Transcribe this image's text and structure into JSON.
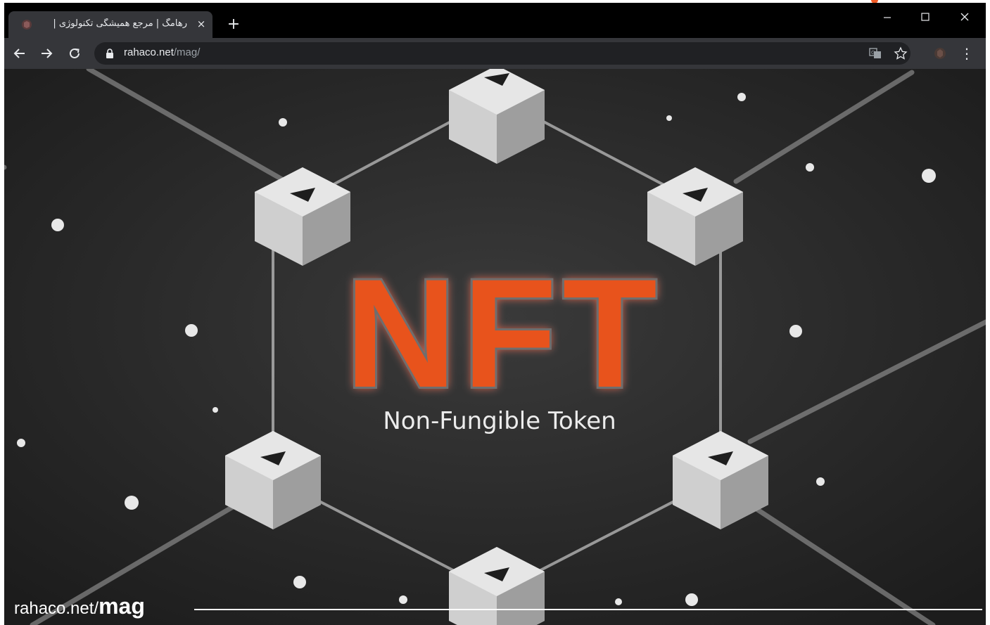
{
  "browser": {
    "tab": {
      "title": "رهامگ | مرجع همیشگی تکنولوژی |",
      "favicon": "rahaco-logo-icon",
      "close": "×"
    },
    "new_tab": "+",
    "window_controls": {
      "minimize": "–",
      "maximize": "□",
      "close": "✕"
    },
    "nav": {
      "back": "←",
      "forward": "→",
      "reload": "⟳"
    },
    "address": {
      "host": "rahaco.net",
      "path": "/mag/"
    },
    "omnibox_icons": [
      "translate-icon",
      "bookmark-star-icon"
    ],
    "extension_icon": "rahaco-extension-icon",
    "menu_icon": "⋮"
  },
  "hero": {
    "headline": "NFT",
    "subheadline": "Non-Fungible Token",
    "accent_color": "#e8531f",
    "node_icon": "ethereum-icon"
  },
  "watermark": {
    "host": "rahaco.net/",
    "path": "mag"
  },
  "colors": {
    "tabbar": "#000000",
    "toolbar": "#35363a",
    "background": "#2a2a2a"
  }
}
